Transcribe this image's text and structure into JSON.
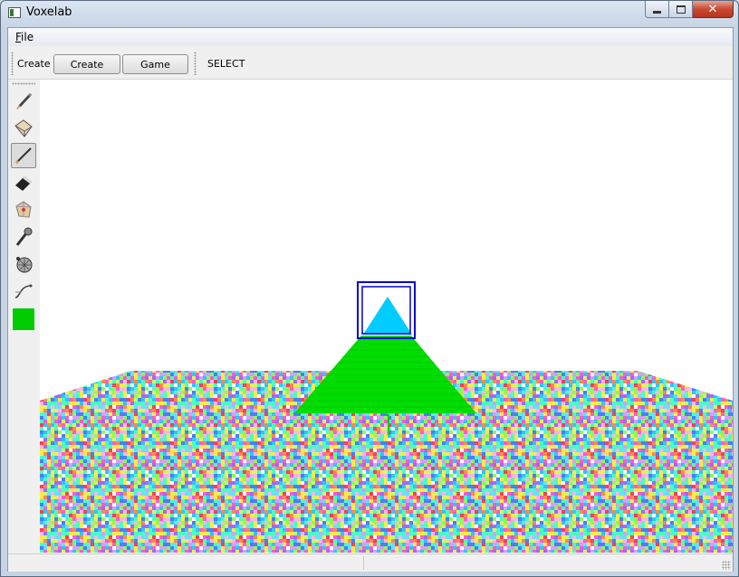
{
  "window": {
    "title": "Voxelab"
  },
  "menu": {
    "file": "File",
    "file_mnemonic": "F",
    "file_rest": "ile"
  },
  "toolbar": {
    "create_label": "Create",
    "create_button": "Create",
    "game_button": "Game",
    "mode_label": "SELECT"
  },
  "tools": [
    {
      "name": "brush-icon",
      "active": false
    },
    {
      "name": "fill-bucket-icon",
      "active": false
    },
    {
      "name": "line-icon",
      "active": true
    },
    {
      "name": "eraser-icon",
      "active": false
    },
    {
      "name": "shape-icon",
      "active": false
    },
    {
      "name": "magic-wand-icon",
      "active": false
    },
    {
      "name": "texture-ball-icon",
      "active": false
    },
    {
      "name": "curve-icon",
      "active": false
    }
  ],
  "colors": {
    "current": "#00cc00",
    "pyramid": "#00dd00",
    "selection_box": "#0000cc",
    "preview": "#00ccff"
  }
}
